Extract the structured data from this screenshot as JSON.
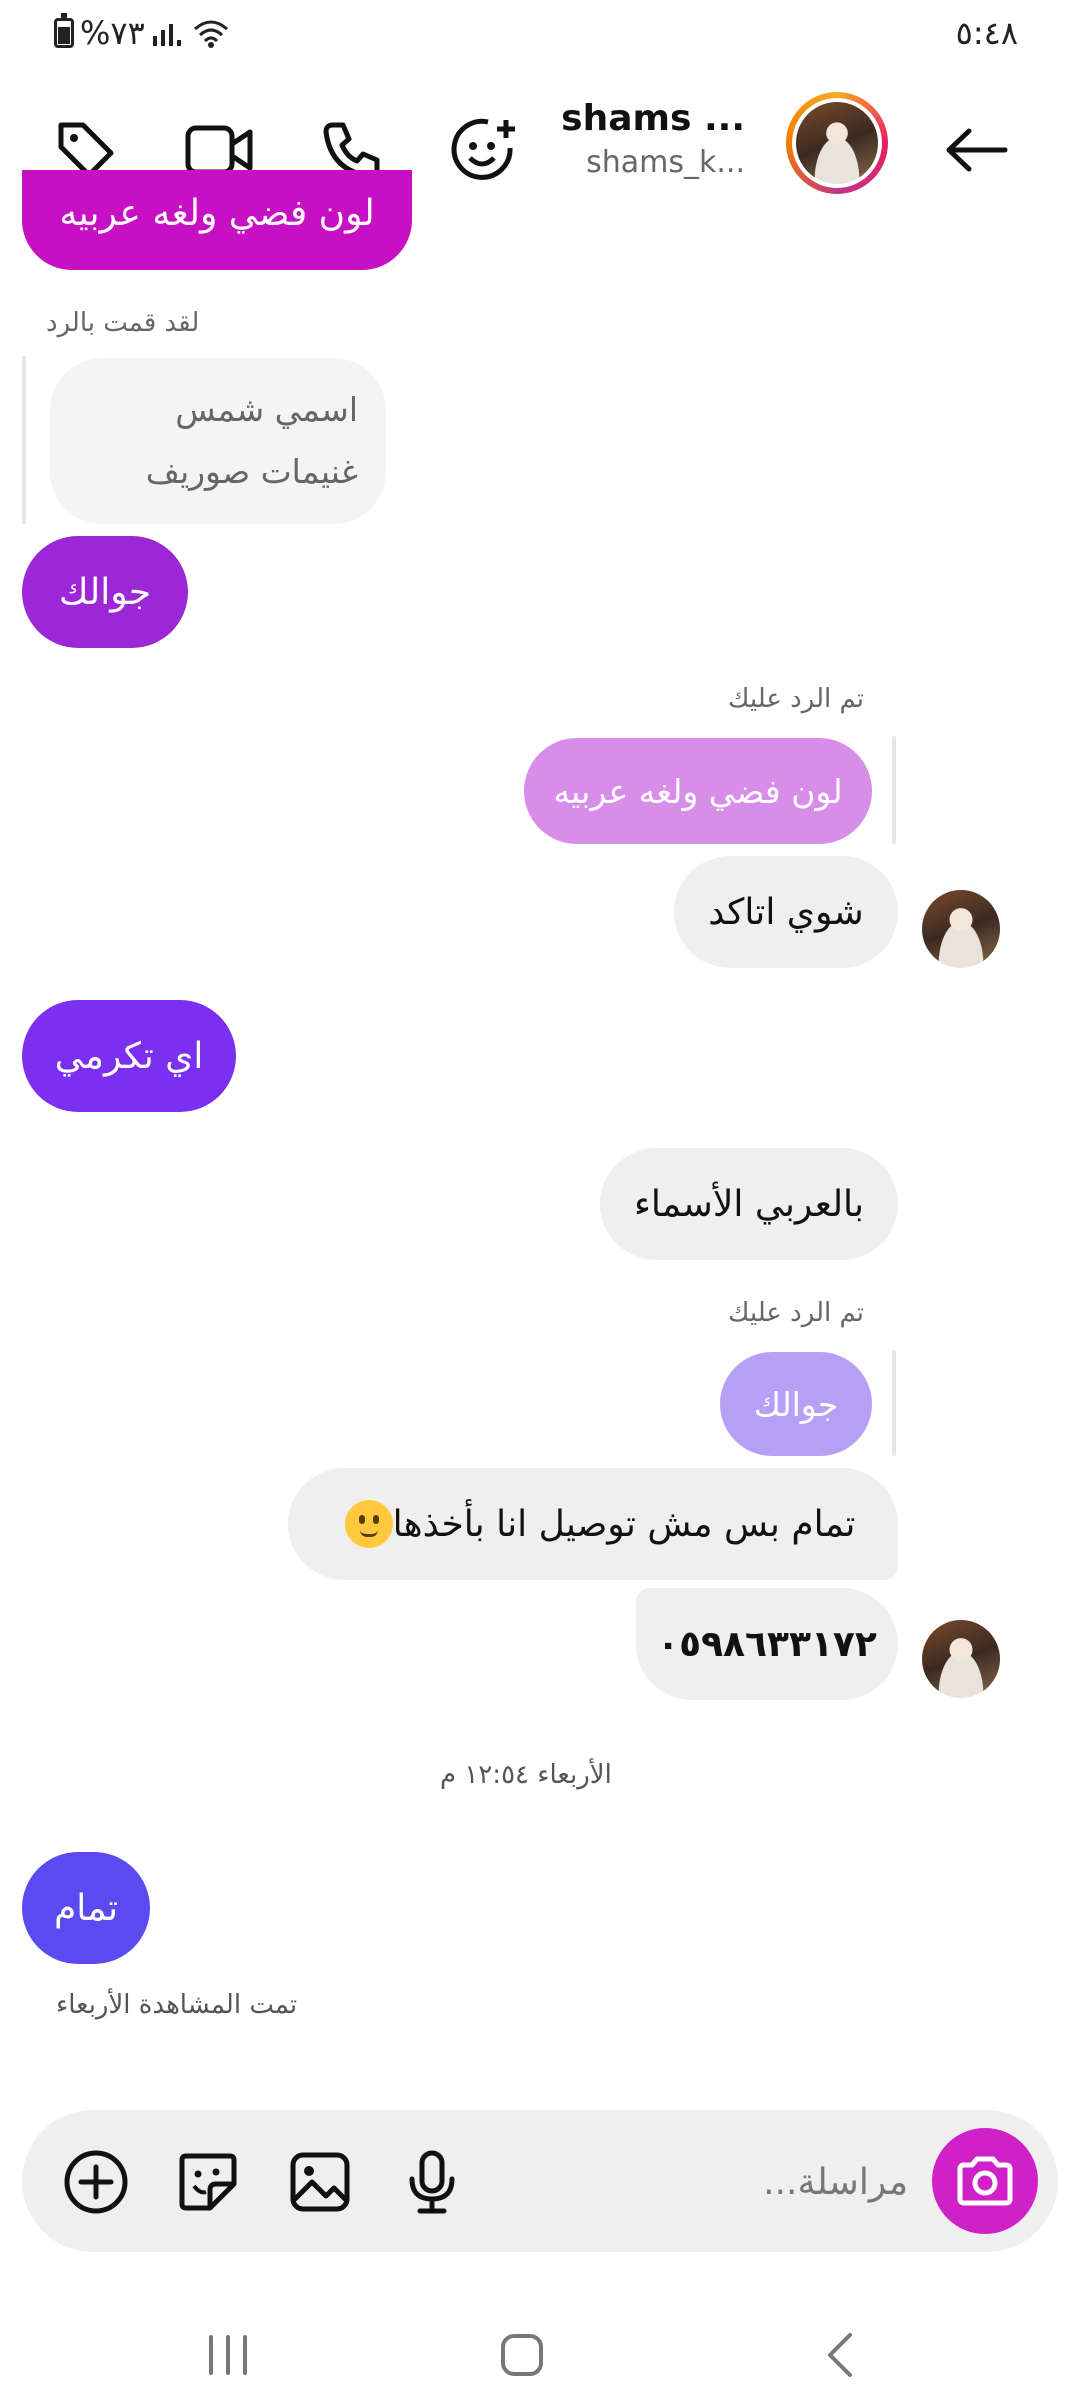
{
  "status_bar": {
    "time": "٥:٤٨",
    "battery": "%٧٣"
  },
  "header": {
    "name": "shams ...",
    "username": "shams_k..."
  },
  "messages": {
    "m0_partial": "لون فضي ولغه عربيه",
    "reply_meta_1": "لقد قمت بالرد",
    "quoted_1": "اسمي شمس غنيمات صوريف",
    "m1": "جوالك",
    "reply_meta_2": "تم الرد عليك",
    "quoted_2": "لون فضي ولغه عربيه",
    "m2": "شوي اتاكد",
    "m3": "اي تكرمي",
    "m4": "بالعربي الأسماء",
    "reply_meta_3": "تم الرد عليك",
    "quoted_3": "جوالك",
    "m5": "تمام بس مش توصيل انا بأخذها",
    "m6": "٠٥٩٨٦٣٣١٧٢",
    "timestamp": "الأربعاء ١٢:٥٤ م",
    "m7": "تمام",
    "seen": "تمت المشاهدة الأربعاء"
  },
  "composer": {
    "placeholder": "مراسلة..."
  },
  "colors": {
    "accent_top": "#c70fc4",
    "purple_1": "#9b27d6",
    "purple_2": "#7b2ff0",
    "purple_3": "#5a4af0",
    "quoted_pink": "#d68ee9",
    "quoted_lilac": "#b6a0f5"
  }
}
